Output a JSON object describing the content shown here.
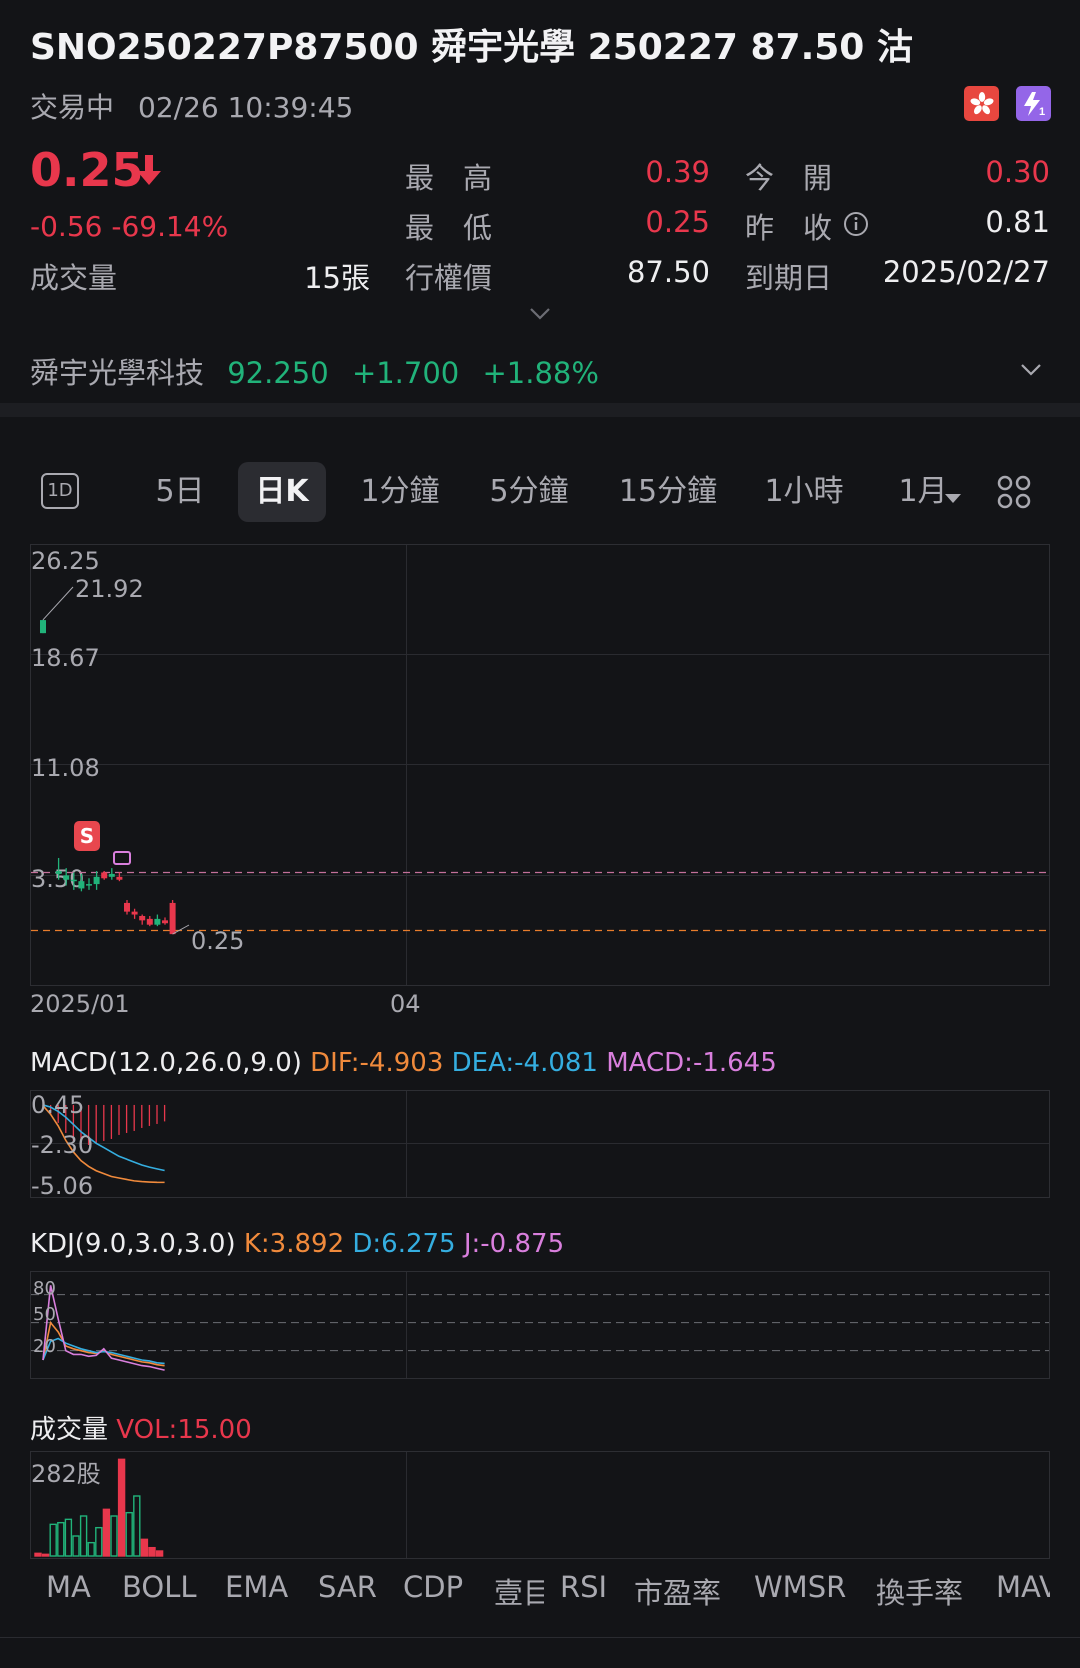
{
  "header": {
    "title": "SNO250227P87500  舜宇光學 250227 87.50 沽",
    "status": "交易中",
    "time": "02/26 10:39:45",
    "price": "0.25",
    "change": "-0.56 -69.14%"
  },
  "quote": {
    "high_label": "最　高",
    "high": "0.39",
    "open_label": "今　開",
    "open": "0.30",
    "low_label": "最　低",
    "low": "0.25",
    "prev_close_label": "昨　收",
    "prev_close": "0.81",
    "volume_label": "成交量",
    "volume": "15張",
    "strike_label": "行權價",
    "strike": "87.50",
    "expiry_label": "到期日",
    "expiry": "2025/02/27"
  },
  "underlying": {
    "name": "舜宇光學科技",
    "price": "92.250",
    "change": "+1.700",
    "pct": "+1.88%"
  },
  "tabs": {
    "t1d": "1D",
    "t5d": "5日",
    "tk": "日K",
    "t1m": "1分鐘",
    "t5m": "5分鐘",
    "t15m": "15分鐘",
    "t1h": "1小時",
    "tmonth": "1月"
  },
  "colors": {
    "up": "#21b37a",
    "down": "#e8374c",
    "dif": "#f08a3c",
    "dea": "#35aee0",
    "macd": "#d97fdd",
    "bg": "#131417"
  },
  "chart_data": [
    {
      "type": "candlestick",
      "title": "日K",
      "y_ticks": [
        "26.25",
        "18.67",
        "11.08",
        "3.50"
      ],
      "x_ticks": [
        "2025/01",
        "04"
      ],
      "ylim": [
        -0.5,
        26.25
      ],
      "annotations": {
        "max": "21.92",
        "min": "0.25"
      },
      "reference_lines": [
        4.5,
        0.5
      ],
      "candles": [
        {
          "o": 21.0,
          "c": 21.9,
          "h": 21.92,
          "l": 21.0
        },
        {
          "o": 4.4,
          "c": 4.6,
          "h": 5.5,
          "l": 4.0
        },
        {
          "o": 4.0,
          "c": 4.3,
          "h": 4.8,
          "l": 3.6
        },
        {
          "o": 3.9,
          "c": 4.0,
          "h": 4.5,
          "l": 3.3
        },
        {
          "o": 3.4,
          "c": 3.9,
          "h": 4.4,
          "l": 3.2
        },
        {
          "o": 3.6,
          "c": 3.7,
          "h": 4.1,
          "l": 3.3
        },
        {
          "o": 3.7,
          "c": 4.2,
          "h": 4.6,
          "l": 3.3
        },
        {
          "o": 4.5,
          "c": 4.1,
          "h": 4.6,
          "l": 4.0
        },
        {
          "o": 4.2,
          "c": 4.4,
          "h": 4.8,
          "l": 4.0
        },
        {
          "o": 4.2,
          "c": 4.0,
          "h": 4.5,
          "l": 3.9
        },
        {
          "o": 2.4,
          "c": 1.8,
          "h": 2.6,
          "l": 1.6
        },
        {
          "o": 1.8,
          "c": 1.6,
          "h": 2.0,
          "l": 1.3
        },
        {
          "o": 1.5,
          "c": 1.2,
          "h": 1.6,
          "l": 0.9
        },
        {
          "o": 1.3,
          "c": 0.9,
          "h": 1.5,
          "l": 0.8
        },
        {
          "o": 0.9,
          "c": 1.3,
          "h": 1.6,
          "l": 0.8
        },
        {
          "o": 1.2,
          "c": 1.0,
          "h": 1.4,
          "l": 0.9
        },
        {
          "o": 2.4,
          "c": 0.25,
          "h": 2.6,
          "l": 0.25
        }
      ]
    },
    {
      "type": "line",
      "title": "MACD(12.0,26.0,9.0)",
      "labels": {
        "dif": "DIF:-4.903",
        "dea": "DEA:-4.081",
        "macd": "MACD:-1.645"
      },
      "y_ticks": [
        "0.45",
        "-2.30",
        "-5.06"
      ],
      "ylim": [
        -5.5,
        1.0
      ],
      "series": [
        {
          "name": "DIF",
          "values": [
            0.4,
            -0.2,
            -1.0,
            -2.0,
            -2.8,
            -3.4,
            -3.8,
            -4.1,
            -4.3,
            -4.5,
            -4.6,
            -4.7,
            -4.8,
            -4.85,
            -4.88,
            -4.9,
            -4.903
          ]
        },
        {
          "name": "DEA",
          "values": [
            0.45,
            0.3,
            0.0,
            -0.4,
            -0.9,
            -1.4,
            -1.8,
            -2.2,
            -2.5,
            -2.8,
            -3.1,
            -3.3,
            -3.5,
            -3.7,
            -3.85,
            -3.97,
            -4.081
          ]
        },
        {
          "name": "MACD",
          "values": [
            -0.1,
            -0.9,
            -1.8,
            -2.8,
            -3.6,
            -3.9,
            -4.0,
            -3.8,
            -3.6,
            -3.4,
            -3.0,
            -2.8,
            -2.6,
            -2.3,
            -2.1,
            -1.9,
            -1.645
          ]
        }
      ]
    },
    {
      "type": "line",
      "title": "KDJ(9.0,3.0,3.0)",
      "labels": {
        "k": "K:3.892",
        "d": "D:6.275",
        "j": "J:-0.875"
      },
      "y_ticks": [
        "80",
        "50",
        "20"
      ],
      "ylim": [
        -5,
        100
      ],
      "series": [
        {
          "name": "K",
          "values": [
            10,
            50,
            40,
            25,
            22,
            20,
            18,
            17,
            20,
            16,
            14,
            12,
            10,
            8,
            7,
            5,
            3.892
          ]
        },
        {
          "name": "D",
          "values": [
            10,
            30,
            33,
            28,
            25,
            22,
            20,
            18,
            19,
            18,
            16,
            14,
            12,
            10,
            9,
            7,
            6.275
          ]
        },
        {
          "name": "J",
          "values": [
            10,
            90,
            54,
            20,
            16,
            16,
            14,
            15,
            22,
            12,
            10,
            8,
            6,
            4,
            3,
            1,
            -0.875
          ]
        }
      ]
    },
    {
      "type": "bar",
      "title": "成交量",
      "label": "VOL:15.00",
      "y_ticks": [
        "282股"
      ],
      "ylim": [
        0,
        300
      ],
      "values": [
        8,
        5,
        95,
        100,
        110,
        60,
        120,
        40,
        85,
        140,
        120,
        290,
        130,
        180,
        50,
        25,
        15
      ],
      "colors": [
        "down",
        "down",
        "up",
        "up",
        "up",
        "up",
        "up",
        "up",
        "up",
        "down",
        "up",
        "down",
        "up",
        "up",
        "down",
        "down",
        "down"
      ]
    }
  ],
  "bottom_tabs": [
    "MA",
    "BOLL",
    "EMA",
    "SAR",
    "CDP",
    "壹目",
    "RSI",
    "市盈率",
    "WMSR",
    "換手率",
    "MAVOL"
  ]
}
